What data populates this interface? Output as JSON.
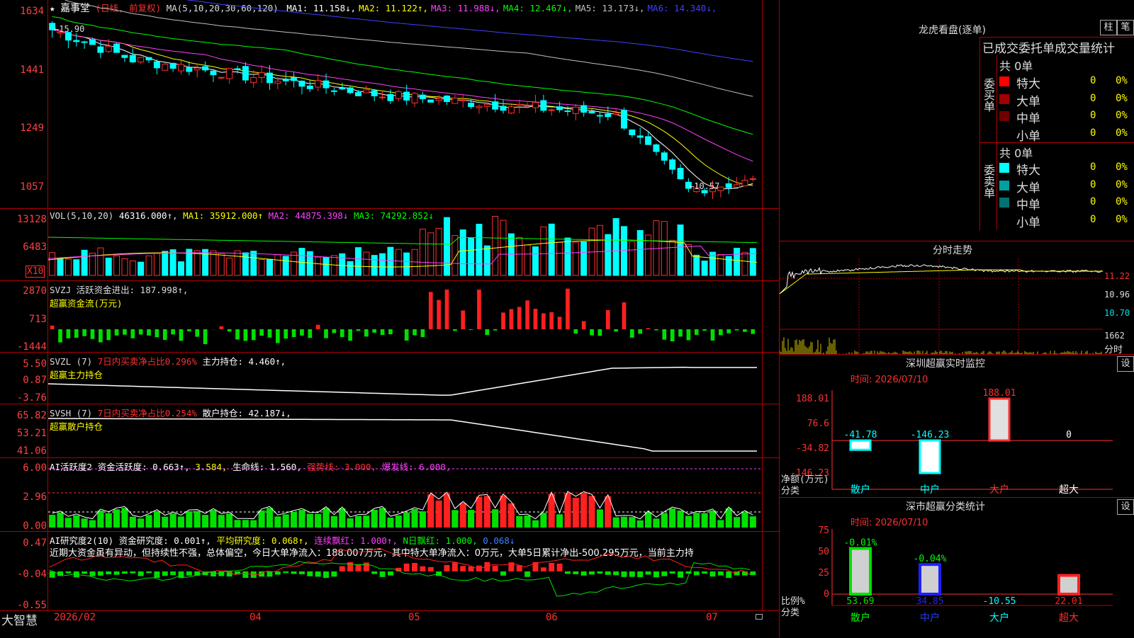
{
  "main": {
    "stock_name": "嘉事堂",
    "mode": "(日线, 前复权)",
    "ma_label": "MA(5,10,20,30,60,120)",
    "ma_values": [
      {
        "name": "MA1",
        "value": "11.158",
        "arrow": "↓",
        "color": "#ffffff"
      },
      {
        "name": "MA2",
        "value": "11.122",
        "arrow": "↑",
        "color": "#ffff00"
      },
      {
        "name": "MA3",
        "value": "11.988",
        "arrow": "↓",
        "color": "#ff40ff"
      },
      {
        "name": "MA4",
        "value": "12.467",
        "arrow": "↓",
        "color": "#00ff00"
      },
      {
        "name": "MA5",
        "value": "13.173",
        "arrow": "↓",
        "color": "#c0c0c0"
      },
      {
        "name": "MA6",
        "value": "14.340",
        "arrow": "↓",
        "color": "#4040ff"
      }
    ],
    "price_axis": [
      "1634",
      "1441",
      "1249",
      "1057"
    ],
    "high_marker": "15.90",
    "low_marker": "10.57"
  },
  "vol": {
    "title": "VOL(5,10,20)",
    "value": "46316.000",
    "ma1": "MA1: 35912.000↑",
    "ma2": "MA2: 44875.398↓",
    "ma3": "MA3: 74292.852↓",
    "axis": [
      "13128",
      "6483"
    ],
    "unit": "X10"
  },
  "svzj": {
    "title": "SVZJ 活跃资金进出: 187.998↑,",
    "subtitle": "超赢资金流(万元)",
    "axis": [
      "2870",
      "713",
      "-1444"
    ]
  },
  "svzl": {
    "title_a": "SVZL (7)",
    "title_b": "7日内买卖净占比0.296%",
    "title_c": "主力持仓: 4.460↑,",
    "subtitle": "超赢主力持仓",
    "axis": [
      "5.50",
      "0.87",
      "-3.76"
    ]
  },
  "svsh": {
    "title_a": "SVSH (7)",
    "title_b": "7日内买卖净占比0.254%",
    "title_c": "散户持仓: 42.187↓,",
    "subtitle": "超赢散户持仓",
    "axis": [
      "65.82",
      "53.21",
      "41.06"
    ]
  },
  "ai_active": {
    "title_a": "AI活跃度2 资金活跃度: 0.663↑,",
    "title_b": "3.584,",
    "title_c": "生命线: 1.560,",
    "title_d": "强势线: 3.000,",
    "title_e": "爆发线: 6.000,",
    "axis": [
      "6.00",
      "2.96",
      "0.00"
    ]
  },
  "ai_research": {
    "title_a": "AI研究度2(10) 资金研究度: 0.001↑,",
    "title_b": "平均研究度: 0.068↑,",
    "title_c": "连续飘红: 1.000↑,",
    "title_d": "N日飘红: 1.000,",
    "title_e": "0.068↓",
    "comment": "近期大资金虽有异动，但持续性不强，总体偏空，今日大单净流入：188.007万元，其中特大单净流入：0万元，大单5日累计净出-500.295万元，当前主力持",
    "axis": [
      "0.47",
      "-0.04",
      "-0.55"
    ]
  },
  "bottom_axis": {
    "logo": "大智慧",
    "months": [
      "2026/02",
      "04",
      "05",
      "06",
      "07"
    ]
  },
  "dragon": {
    "title": "龙虎看盘(逐单)",
    "btn_bar": "柱",
    "btn_pen": "笔",
    "stat_title": "已成交委托单成交量统计",
    "buy_label": "委买单",
    "sell_label": "委卖单",
    "buy_total": "共 0单",
    "sell_total": "共 0单",
    "buy_rows": [
      {
        "name": "特大",
        "n": "0",
        "pct": "0%",
        "color": "#ff0000"
      },
      {
        "name": "大单",
        "n": "0",
        "pct": "0%",
        "color": "#a00000"
      },
      {
        "name": "中单",
        "n": "0",
        "pct": "0%",
        "color": "#700000"
      },
      {
        "name": "小单",
        "n": "0",
        "pct": "0%",
        "color": "#000000"
      }
    ],
    "sell_rows": [
      {
        "name": "特大",
        "n": "0",
        "pct": "0%",
        "color": "#00ffff"
      },
      {
        "name": "大单",
        "n": "0",
        "pct": "0%",
        "color": "#00a0a0"
      },
      {
        "name": "中单",
        "n": "0",
        "pct": "0%",
        "color": "#007070"
      },
      {
        "name": "小单",
        "n": "0",
        "pct": "0%",
        "color": "#000000"
      }
    ]
  },
  "intraday": {
    "title": "分时走势",
    "axis": [
      "11.22",
      "10.96",
      "10.70"
    ],
    "vol_axis": "1662",
    "vol_label": "分时"
  },
  "monitor": {
    "title": "深圳超赢实时监控",
    "setting": "设",
    "time": "时间: 2026/07/10",
    "axis": [
      "188.01",
      "76.6",
      "-34.82",
      "-146.23"
    ],
    "bars": [
      {
        "cat": "散户",
        "value": -41.78,
        "label": "-41.78"
      },
      {
        "cat": "中户",
        "value": -146.23,
        "label": "-146.23"
      },
      {
        "cat": "大户",
        "value": 188.01,
        "label": "188.01"
      },
      {
        "cat": "超大",
        "value": 0,
        "label": "0"
      }
    ],
    "ylabel": "净额(万元)",
    "xlabel": "分类"
  },
  "classify": {
    "title": "深市超赢分类统计",
    "setting": "设",
    "time": "时间: 2026/07/10",
    "axis": [
      "75",
      "50",
      "25",
      "0"
    ],
    "bars": [
      {
        "cat": "散户",
        "value": 53.69,
        "label": "53.69",
        "change": "-0.01%"
      },
      {
        "cat": "中户",
        "value": 34.85,
        "label": "34.85",
        "change": "-0.04%"
      },
      {
        "cat": "大户",
        "value": -10.55,
        "label": "-10.55",
        "change": ""
      },
      {
        "cat": "超大",
        "value": 22.01,
        "label": "22.01",
        "change": ""
      }
    ],
    "ylabel": "比例%",
    "xlabel": "分类"
  }
}
